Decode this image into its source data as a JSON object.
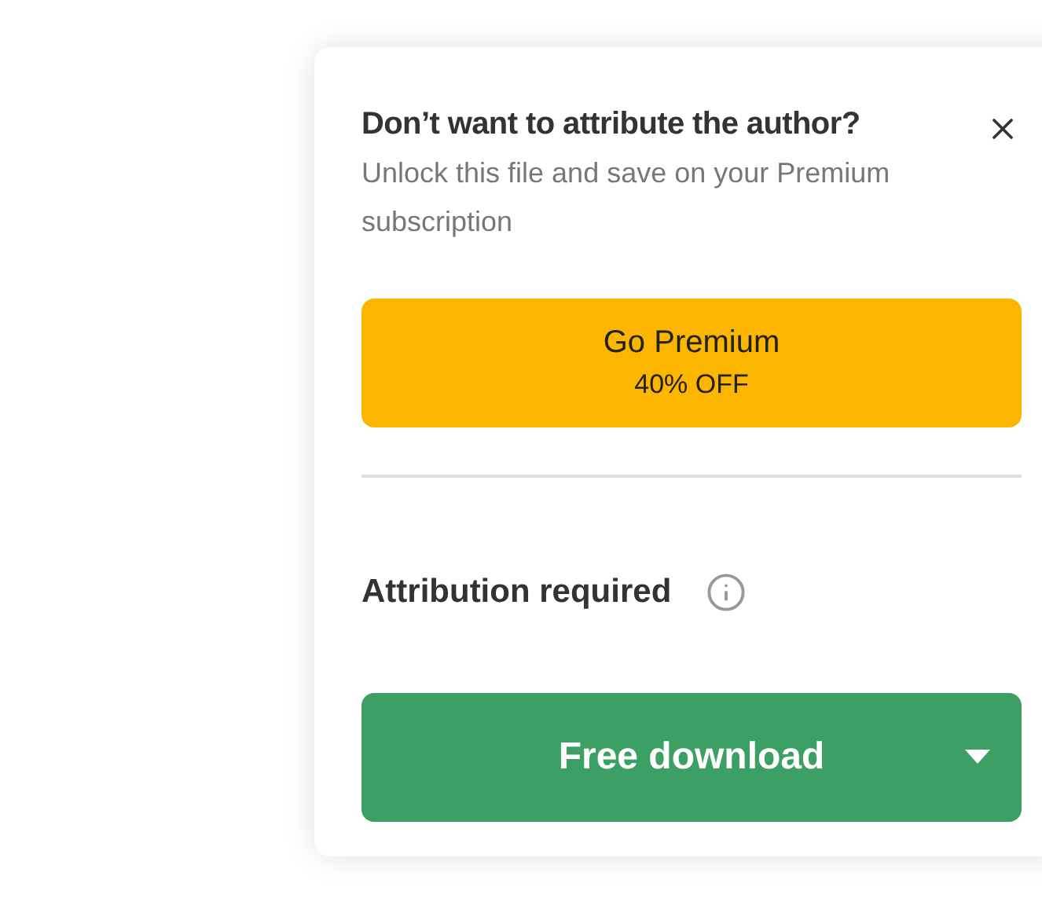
{
  "promo": {
    "title": "Don’t want to attribute the author?",
    "subtitle": "Unlock this file and save on your Premium subscription",
    "button": {
      "label": "Go Premium",
      "discount": "40% OFF"
    }
  },
  "attribution": {
    "label": "Attribution required"
  },
  "download": {
    "label": "Free download"
  }
}
